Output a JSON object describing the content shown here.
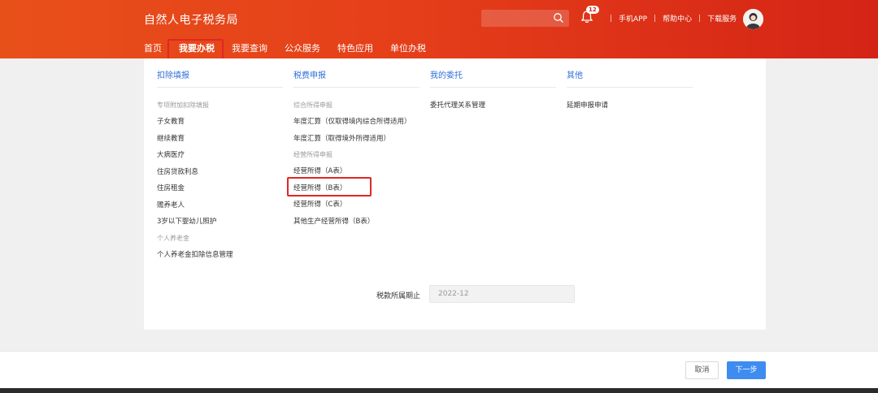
{
  "header": {
    "title": "自然人电子税务局",
    "notification_count": "12",
    "links": [
      "手机APP",
      "帮助中心",
      "下载服务"
    ],
    "search_placeholder": ""
  },
  "nav": {
    "items": [
      "首页",
      "我要办税",
      "我要查询",
      "公众服务",
      "特色应用",
      "单位办税"
    ],
    "active": "我要办税"
  },
  "menu": {
    "columns": [
      {
        "title": "扣除填报",
        "entries": [
          {
            "type": "group",
            "text": "专项附加扣除填报"
          },
          {
            "type": "item",
            "text": "子女教育"
          },
          {
            "type": "item",
            "text": "继续教育"
          },
          {
            "type": "item",
            "text": "大病医疗"
          },
          {
            "type": "item",
            "text": "住房贷款利息"
          },
          {
            "type": "item",
            "text": "住房租金"
          },
          {
            "type": "item",
            "text": "赡养老人"
          },
          {
            "type": "item",
            "text": "3岁以下婴幼儿照护"
          },
          {
            "type": "group",
            "text": "个人养老金"
          },
          {
            "type": "item",
            "text": "个人养老金扣除信息管理"
          }
        ]
      },
      {
        "title": "税费申报",
        "entries": [
          {
            "type": "group",
            "text": "综合所得申报"
          },
          {
            "type": "item",
            "text": "年度汇算（仅取得境内综合所得适用）"
          },
          {
            "type": "item",
            "text": "年度汇算（取得境外所得适用）"
          },
          {
            "type": "group",
            "text": "经营所得申报"
          },
          {
            "type": "item",
            "text": "经营所得（A表）"
          },
          {
            "type": "item",
            "text": "经营所得（B表）"
          },
          {
            "type": "item",
            "text": "经营所得（C表）"
          },
          {
            "type": "item",
            "text": "其他生产经营所得（B表）"
          }
        ]
      },
      {
        "title": "我的委托",
        "entries": [
          {
            "type": "item",
            "text": "委托代理关系管理"
          }
        ]
      },
      {
        "title": "其他",
        "entries": [
          {
            "type": "item",
            "text": "延期申报申请"
          }
        ]
      }
    ]
  },
  "form": {
    "period_label": "税款所属期止",
    "period_value": "2022-12"
  },
  "footer": {
    "cancel_label": "取消",
    "next_label": "下一步"
  },
  "colors": {
    "header_start": "#e8501a",
    "header_end": "#d42416",
    "link_blue": "#2f6fd8",
    "primary_button": "#3f8cf0",
    "highlight_red": "#e02626"
  }
}
